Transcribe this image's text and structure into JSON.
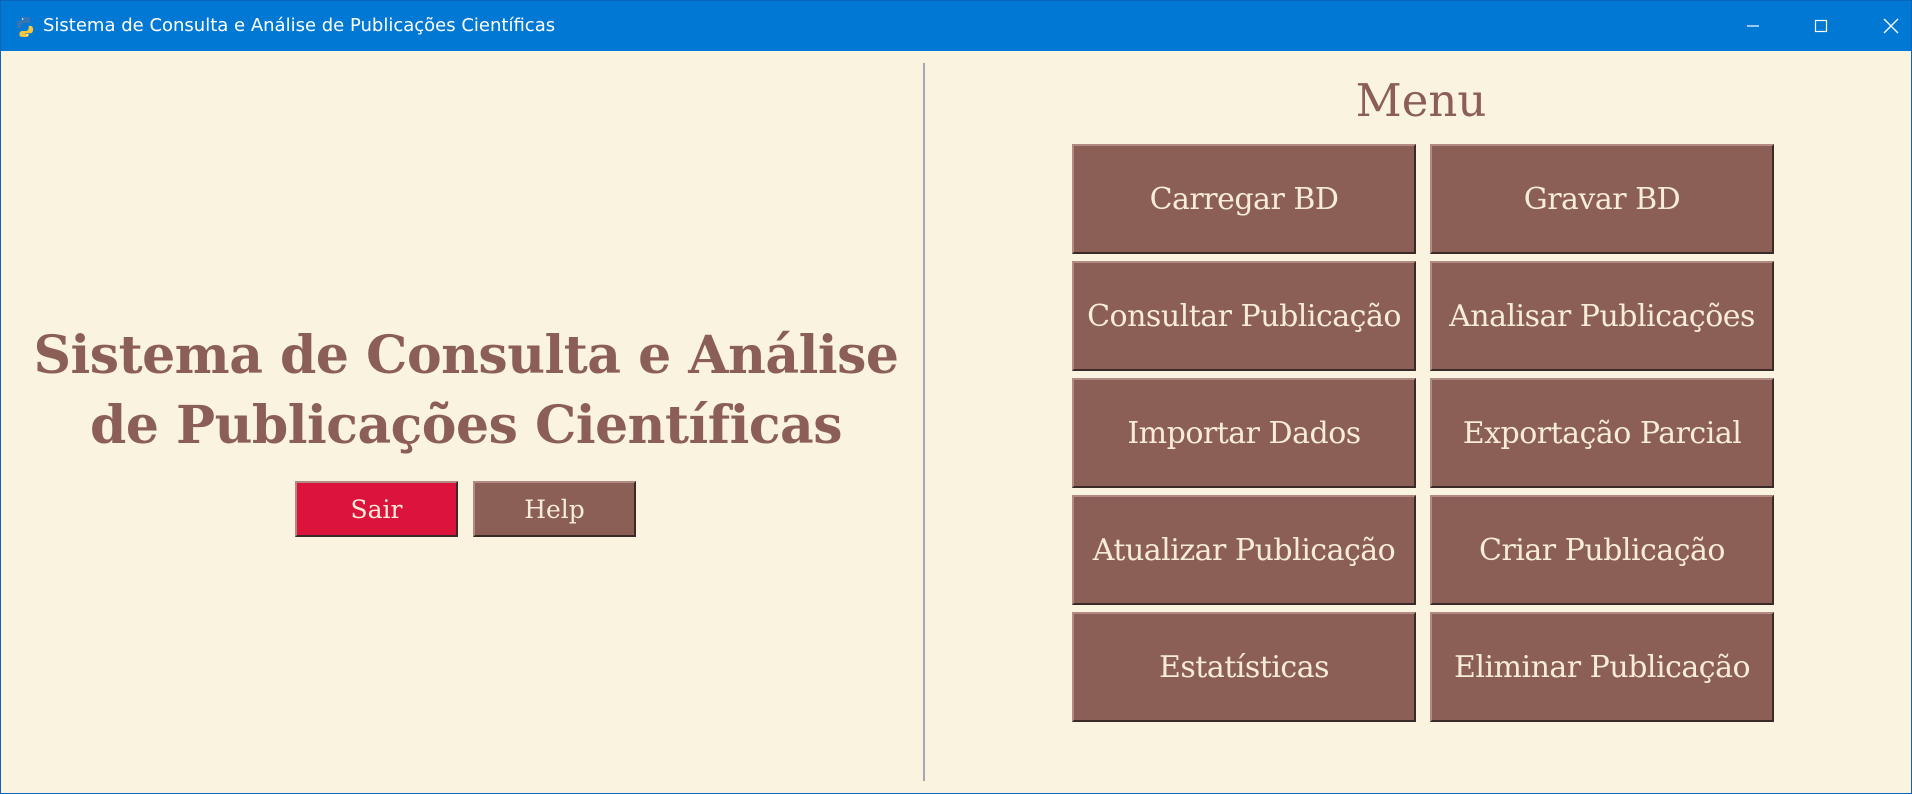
{
  "window": {
    "title": "Sistema de Consulta e Análise de Publicações Científicas",
    "icon": "python-icon",
    "controls": [
      "minimize-icon",
      "maximize-icon",
      "close-icon"
    ]
  },
  "left_panel": {
    "title_line1": "Sistema de Consulta e Análise",
    "title_line2": "de Publicações Científicas",
    "exit_label": "Sair",
    "help_label": "Help"
  },
  "menu": {
    "title": "Menu",
    "buttons": [
      {
        "label": "Carregar BD"
      },
      {
        "label": "Gravar BD"
      },
      {
        "label": "Consultar Publicação"
      },
      {
        "label": "Analisar Publicações"
      },
      {
        "label": "Importar Dados"
      },
      {
        "label": "Exportação Parcial"
      },
      {
        "label": "Atualizar Publicação"
      },
      {
        "label": "Criar Publicação"
      },
      {
        "label": "Estatísticas"
      },
      {
        "label": "Eliminar Publicação"
      }
    ]
  },
  "colors": {
    "titlebar": "#0078d4",
    "background": "#faf3e0",
    "button": "#8b5e56",
    "exit_button": "#dc143c",
    "button_text": "#f7ecd8",
    "title_text": "#8b5e56",
    "divider": "#a7a7b3"
  }
}
